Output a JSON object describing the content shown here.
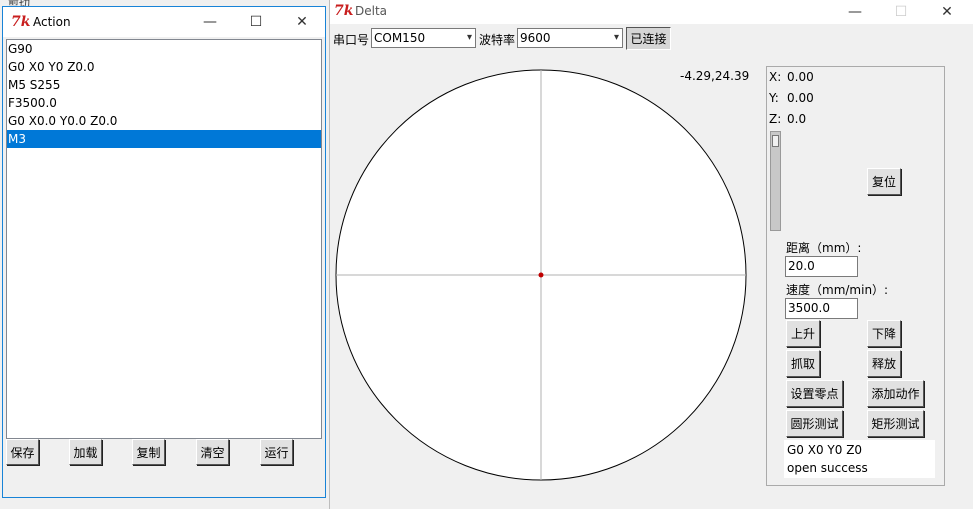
{
  "background": {
    "text": "剪切"
  },
  "delta_window": {
    "title": "Delta",
    "controls": {
      "minimize": "—",
      "maximize": "☐",
      "close": "✕"
    },
    "port_label": "串口号",
    "port_value": "COM150",
    "baud_label": "波特率",
    "baud_value": "9600",
    "connect_button": "已连接",
    "coord_readout": "-4.29,24.39",
    "x_label": "X:",
    "x_value": "0.00",
    "y_label": "Y:",
    "y_value": "0.00",
    "z_label": "Z:",
    "z_value": "0.0",
    "reset_button": "复位",
    "distance_label": "距离（mm）:",
    "distance_value": "20.0",
    "speed_label": "速度（mm/min）:",
    "speed_value": "3500.0",
    "up_button": "上升",
    "down_button": "下降",
    "grab_button": "抓取",
    "release_button": "释放",
    "set_zero_button": "设置零点",
    "add_action_button": "添加动作",
    "circle_test_button": "圆形测试",
    "rect_test_button": "矩形测试",
    "log_lines": [
      "G0 X0 Y0 Z0",
      "open success"
    ]
  },
  "action_window": {
    "title": "Action",
    "controls": {
      "minimize": "—",
      "maximize": "☐",
      "close": "✕"
    },
    "items": [
      "G90",
      "G0 X0 Y0 Z0.0",
      "M5 S255",
      "F3500.0",
      "G0 X0.0 Y0.0 Z0.0",
      "M3"
    ],
    "selected_index": 5,
    "save_button": "保存",
    "load_button": "加载",
    "copy_button": "复制",
    "clear_button": "清空",
    "run_button": "运行"
  },
  "colors": {
    "selection": "#0078d7",
    "cursor_dot": "#c00000",
    "tk_logo": "#c81e1e"
  }
}
